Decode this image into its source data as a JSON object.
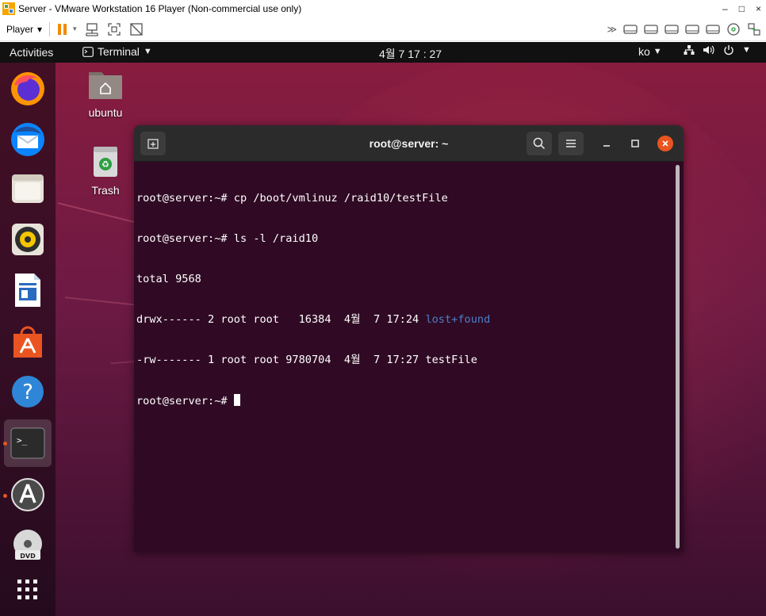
{
  "vmware": {
    "title": "Server - VMware Workstation 16 Player (Non-commercial use only)",
    "window_controls": [
      "–",
      "□",
      "×"
    ],
    "player_menu_label": "Player",
    "toolbar_icons": [
      "pause-icon",
      "send-ctrl-alt-del-icon",
      "fullscreen-icon",
      "unity-icon"
    ],
    "device_icons": [
      "more-devices-icon",
      "hdd-icon",
      "hdd-icon",
      "hdd-icon",
      "hdd-icon",
      "hdd-icon",
      "cd-icon",
      "network-icon"
    ]
  },
  "topbar": {
    "activities": "Activities",
    "app_menu": "Terminal",
    "clock": "4월 7  17 : 27",
    "language": "ko",
    "status_icons": [
      "network-icon",
      "volume-icon",
      "power-icon"
    ]
  },
  "dock": {
    "items": [
      {
        "name": "firefox"
      },
      {
        "name": "thunderbird"
      },
      {
        "name": "files"
      },
      {
        "name": "rhythmbox"
      },
      {
        "name": "libreoffice-writer"
      },
      {
        "name": "software-center"
      },
      {
        "name": "help"
      },
      {
        "name": "terminal",
        "active": true,
        "running": true
      },
      {
        "name": "software-updater",
        "running": true
      },
      {
        "name": "dvd"
      },
      {
        "name": "show-applications"
      }
    ]
  },
  "desktop": {
    "icons": [
      {
        "label": "ubuntu",
        "icon": "home-folder-icon"
      },
      {
        "label": "Trash",
        "icon": "trash-icon"
      }
    ]
  },
  "terminal": {
    "title": "root@server: ~",
    "lines": [
      {
        "text": "root@server:~# cp /boot/vmlinuz /raid10/testFile"
      },
      {
        "text": "root@server:~# ls -l /raid10"
      },
      {
        "text": "total 9568"
      },
      {
        "text": "drwx------ 2 root root   16384  4월  7 17:24 ",
        "highlight": "lost+found"
      },
      {
        "text": "-rw------- 1 root root 9780704  4월  7 17:27 testFile"
      },
      {
        "text": "root@server:~# ",
        "cursor": true
      }
    ],
    "colors": {
      "background": "#300a24",
      "directory": "#4a7fc9",
      "close_button": "#e95420"
    }
  }
}
